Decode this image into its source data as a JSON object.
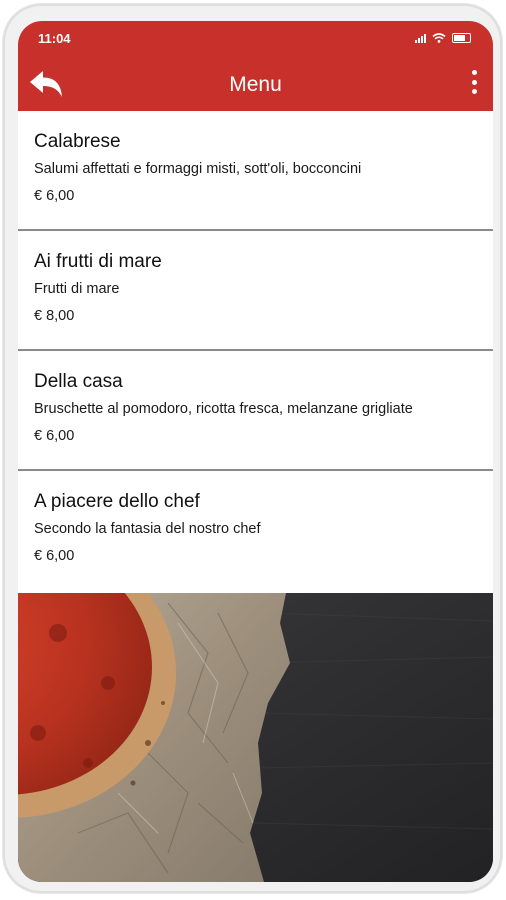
{
  "status_bar": {
    "time": "11:04"
  },
  "header": {
    "title": "Menu",
    "back_icon": "back-arrow-icon",
    "more_icon": "more-vertical-icon"
  },
  "colors": {
    "accent": "#c8302b",
    "divider": "#8a8a8a"
  },
  "items": [
    {
      "name": "Calabrese",
      "description": "Salumi affettati e formaggi misti, sott'oli, bocconcini",
      "price": "€ 6,00"
    },
    {
      "name": "Ai frutti di mare",
      "description": "Frutti di mare",
      "price": "€ 8,00"
    },
    {
      "name": "Della casa",
      "description": "Bruschette al pomodoro, ricotta fresca, melanzane grigliate",
      "price": "€ 6,00"
    },
    {
      "name": "A piacere dello chef",
      "description": "Secondo la fantasia del nostro chef",
      "price": "€ 6,00"
    }
  ]
}
